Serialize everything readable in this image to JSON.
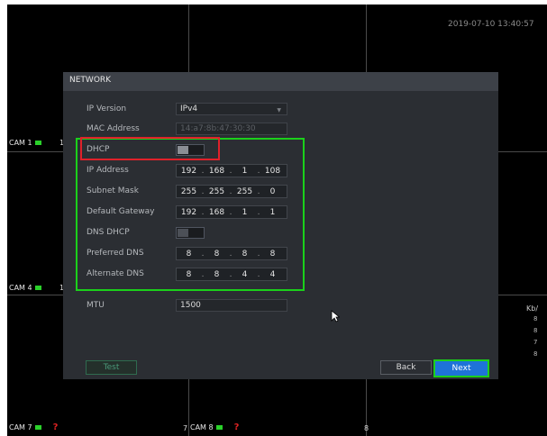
{
  "timestamp": "2019-07-10 13:40:57",
  "cameras": {
    "cam1": "CAM 1",
    "cam4": "CAM 4",
    "cam7": "CAM 7",
    "cam8": "CAM 8",
    "missing_mark": "?",
    "digit_7": "7",
    "digit_8": "8"
  },
  "bandwidth": {
    "unit": "Kb/",
    "values": [
      "8",
      "8",
      "7",
      "8"
    ]
  },
  "network": {
    "title": "NETWORK",
    "ip_version": {
      "label": "IP Version",
      "value": "IPv4"
    },
    "mac_address": {
      "label": "MAC Address",
      "value": "14:a7:8b:47:30:30"
    },
    "dhcp": {
      "label": "DHCP",
      "enabled": false
    },
    "ip_address": {
      "label": "IP Address",
      "octets": [
        "192",
        "168",
        "1",
        "108"
      ]
    },
    "subnet_mask": {
      "label": "Subnet Mask",
      "octets": [
        "255",
        "255",
        "255",
        "0"
      ]
    },
    "default_gateway": {
      "label": "Default Gateway",
      "octets": [
        "192",
        "168",
        "1",
        "1"
      ]
    },
    "dns_dhcp": {
      "label": "DNS DHCP",
      "enabled": false
    },
    "preferred_dns": {
      "label": "Preferred DNS",
      "octets": [
        "8",
        "8",
        "8",
        "8"
      ]
    },
    "alternate_dns": {
      "label": "Alternate DNS",
      "octets": [
        "8",
        "8",
        "4",
        "4"
      ]
    },
    "mtu": {
      "label": "MTU",
      "value": "1500"
    }
  },
  "buttons": {
    "test": "Test",
    "back": "Back",
    "next": "Next"
  },
  "colors": {
    "highlight_red": "#e0212a",
    "highlight_green": "#1bd01b",
    "primary_button": "#1e73d8",
    "recording_indicator": "#2ad12a"
  }
}
